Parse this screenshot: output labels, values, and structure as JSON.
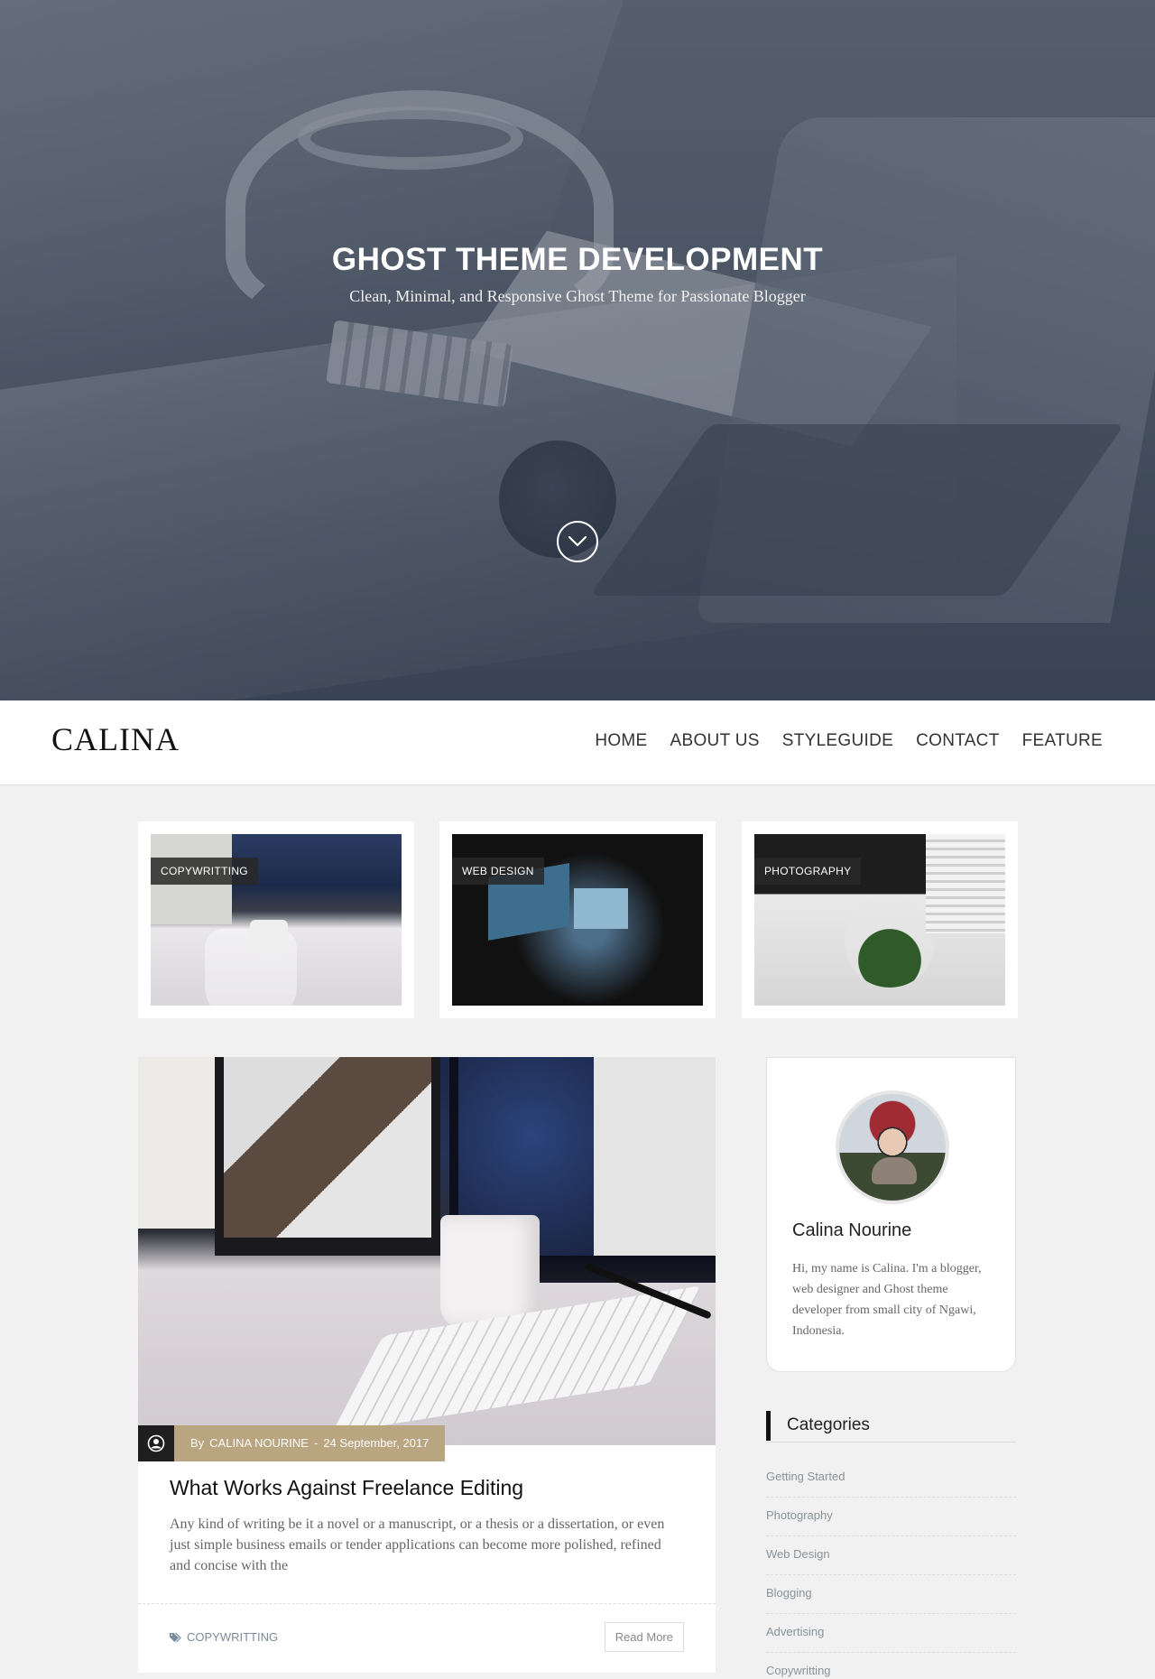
{
  "hero": {
    "title": "GHOST THEME DEVELOPMENT",
    "subtitle": "Clean, Minimal, and Responsive Ghost Theme for Passionate Blogger",
    "scroll_icon": "chevron-down-circle-icon"
  },
  "nav": {
    "logo": "CALINA",
    "items": [
      "HOME",
      "ABOUT US",
      "STYLEGUIDE",
      "CONTACT",
      "FEATURE"
    ]
  },
  "featured_categories": [
    {
      "label": "COPYWRITTING"
    },
    {
      "label": "WEB DESIGN"
    },
    {
      "label": "PHOTOGRAPHY"
    }
  ],
  "post": {
    "author_prefix": "By",
    "author": "CALINA NOURINE",
    "separator": "-",
    "date": "24 September, 2017",
    "title": "What Works Against Freelance Editing",
    "excerpt": "Any kind of writing be it a novel or a manuscript, or a thesis or a dissertation, or even just simple business emails or tender applications can become more polished, refined and concise with the",
    "tag": "COPYWRITTING",
    "read_more": "Read More",
    "meta_color": "#b9a57f"
  },
  "author_card": {
    "name": "Calina Nourine",
    "bio": "Hi, my name is Calina. I'm a blogger, web designer and Ghost theme developer from small city of Ngawi, Indonesia."
  },
  "categories": {
    "title": "Categories",
    "items": [
      "Getting Started",
      "Photography",
      "Web Design",
      "Blogging",
      "Advertising",
      "Copywritting"
    ]
  }
}
